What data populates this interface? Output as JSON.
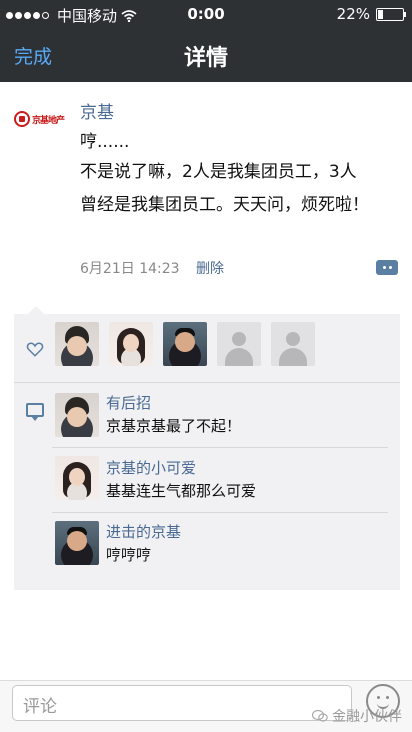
{
  "status_bar": {
    "carrier": "中国移动",
    "time": "0:00",
    "battery": "22%",
    "battery_level": 0.22
  },
  "nav": {
    "done_label": "完成",
    "title": "详情"
  },
  "post": {
    "logo_text": "京基地产",
    "username": "京基",
    "line1": "哼......",
    "line2": "不是说了嘛，2人是我集团员工，3人",
    "line3": "曾经是我集团员工。天天问，烦死啦！",
    "date": "6月21日",
    "time": "14:23",
    "delete_label": "删除"
  },
  "comments": [
    {
      "name": "有后招",
      "text": "京基京基最了不起！"
    },
    {
      "name": "京基的小可爱",
      "text": "基基连生气都那么可爱"
    },
    {
      "name": "进击的京基",
      "text": "哼哼哼"
    }
  ],
  "input": {
    "placeholder": "评论"
  },
  "watermark": {
    "right": "金融小伙伴"
  },
  "colors": {
    "nav_bg": "#2d3134",
    "link": "#58a9f7",
    "name": "#4a6a93",
    "panel": "#f1f1f3"
  },
  "icons": {
    "like": "heart-icon",
    "comment": "comment-bubble-icon",
    "more": "more-dots-icon",
    "emoji": "emoji-icon",
    "wifi": "wifi-icon"
  }
}
